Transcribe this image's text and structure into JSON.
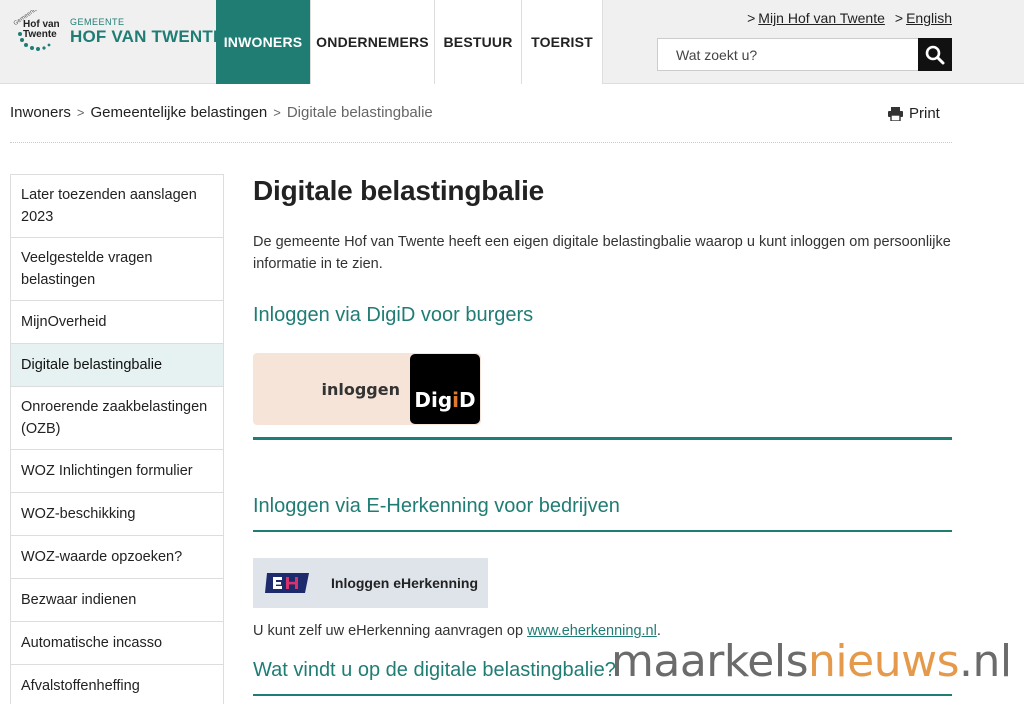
{
  "logo": {
    "mark_top": "Gemeente",
    "mark_line1": "Hof van",
    "mark_line2": "Twente",
    "small": "GEMEENTE",
    "big": "HOF VAN TWENTE"
  },
  "nav": {
    "items": [
      {
        "label": "INWONERS"
      },
      {
        "label": "ONDERNEMERS"
      },
      {
        "label": "BESTUUR"
      },
      {
        "label": "TOERIST"
      }
    ]
  },
  "toplinks": {
    "mijn": "Mijn Hof van Twente",
    "english": "English",
    "arrow": ">"
  },
  "search": {
    "placeholder": "Wat zoekt u?",
    "icon": "search-icon"
  },
  "breadcrumb": {
    "items": [
      "Inwoners",
      "Gemeentelijke belastingen",
      "Digitale belastingbalie"
    ],
    "separator": ">"
  },
  "print": {
    "label": "Print",
    "icon": "printer-icon"
  },
  "sidebar": {
    "items": [
      {
        "label": "Later toezenden aanslagen 2023"
      },
      {
        "label": "Veelgestelde vragen belastingen"
      },
      {
        "label": "MijnOverheid"
      },
      {
        "label": "Digitale belastingbalie"
      },
      {
        "label": "Onroerende zaakbelastingen (OZB)"
      },
      {
        "label": "WOZ Inlichtingen formulier"
      },
      {
        "label": "WOZ-beschikking"
      },
      {
        "label": "WOZ-waarde opzoeken?"
      },
      {
        "label": "Bezwaar indienen"
      },
      {
        "label": "Automatische incasso"
      },
      {
        "label": "Afvalstoffenheffing"
      }
    ]
  },
  "main": {
    "title": "Digitale belastingbalie",
    "intro": "De gemeente Hof van Twente heeft een eigen digitale belastingbalie waarop u kunt inloggen om persoonlijke informatie in te zien.",
    "digid_heading": "Inloggen via DigiD voor burgers",
    "digid_button": {
      "label": "inloggen",
      "logo_a": "Dig",
      "logo_b": "i",
      "logo_c": "D"
    },
    "eh_heading": "Inloggen via E-Herkenning voor bedrijven",
    "eh_button": {
      "label": "Inloggen eHerkenning"
    },
    "eh_note_prefix": "U kunt zelf uw eHerkenning aanvragen op ",
    "eh_note_link": "www.eherkenning.nl",
    "eh_note_suffix": ".",
    "what_heading": "Wat vindt u op de digitale belastingbalie?"
  },
  "watermark": {
    "part1": "maarkels",
    "part2": "nieuws",
    "part3": ".nl"
  },
  "colors": {
    "accent": "#1f7d74",
    "active_bg": "#e6f2f1",
    "digid_orange": "#e07a2e"
  }
}
